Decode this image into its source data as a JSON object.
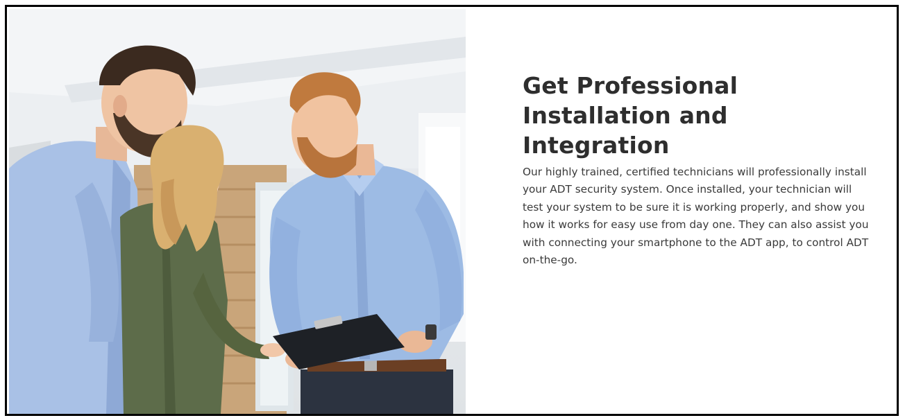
{
  "hero": {
    "image_alt": "Technician showing a couple a clipboard",
    "headline_lines": [
      "Get Professional",
      "Installation and",
      "Integration"
    ],
    "body": "Our highly trained, certified technicians will professionally install your ADT security system. Once installed, your technician will test your system to be sure it is working properly, and show you how it works for easy use from day one. They can also assist you with connecting your smartphone to the ADT app, to control ADT on-the-go."
  },
  "colors": {
    "frame_border": "#000000",
    "headline": "#2e2e2e",
    "body_text": "#3a3a3a",
    "shirt_blue": "#9db8e0",
    "blouse_green": "#5b6a48",
    "hair_red": "#b8743c",
    "hair_blonde": "#d9b070"
  }
}
